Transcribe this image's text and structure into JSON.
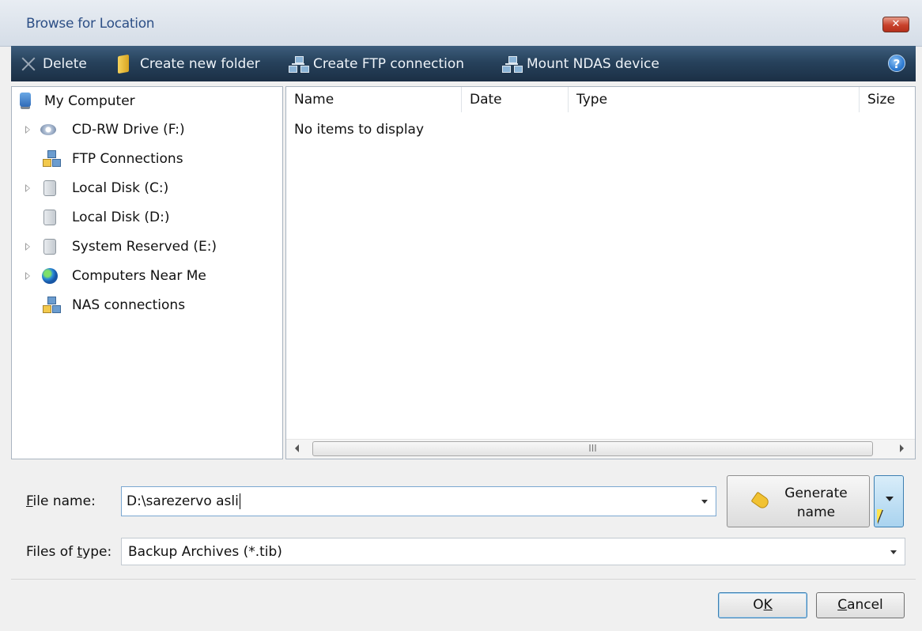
{
  "window": {
    "title": "Browse for Location",
    "close_label": "✕"
  },
  "toolbar": {
    "delete_label": "Delete",
    "create_folder_label": "Create new folder",
    "create_ftp_label": "Create FTP connection",
    "mount_ndas_label": "Mount NDAS device",
    "help_label": "?"
  },
  "tree": {
    "items": [
      {
        "label": "My Computer",
        "icon": "computer-icon",
        "expandable": false
      },
      {
        "label": "CD-RW Drive (F:)",
        "icon": "cd-drive-icon",
        "expandable": true
      },
      {
        "label": "FTP Connections",
        "icon": "network-icon",
        "expandable": false
      },
      {
        "label": "Local Disk (C:)",
        "icon": "disk-icon",
        "expandable": true
      },
      {
        "label": "Local Disk (D:)",
        "icon": "disk-icon",
        "expandable": false
      },
      {
        "label": "System Reserved (E:)",
        "icon": "disk-icon",
        "expandable": true
      },
      {
        "label": "Computers Near Me",
        "icon": "globe-icon",
        "expandable": true
      },
      {
        "label": "NAS connections",
        "icon": "network-icon",
        "expandable": false
      }
    ]
  },
  "list": {
    "columns": [
      "Name",
      "Date",
      "Type",
      "Size"
    ],
    "empty_text": "No items to display",
    "scroll_grip": "III"
  },
  "form": {
    "file_name_label_accel": "F",
    "file_name_label_rest": "ile name:",
    "file_name_value": "D:\\sarezervo asli",
    "files_of_type_label_pre": "Files of ",
    "files_of_type_label_accel": "t",
    "files_of_type_label_post": "ype:",
    "files_of_type_value": "Backup Archives (*.tib)",
    "generate_line1": "Generate",
    "generate_line2": "name"
  },
  "buttons": {
    "ok_pre": "O",
    "ok_accel": "K",
    "cancel_accel": "C",
    "cancel_rest": "ancel"
  },
  "colors": {
    "toolbar_bg": "#27425c",
    "title_text": "#2d4f86",
    "close_btn": "#c8412b"
  }
}
